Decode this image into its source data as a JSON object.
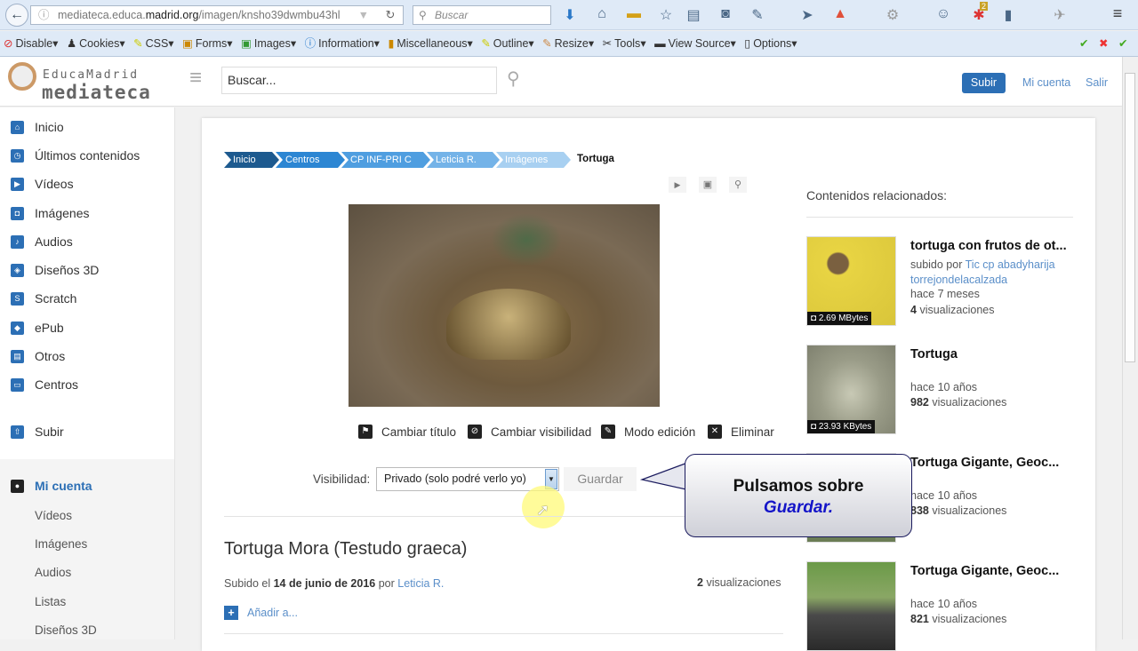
{
  "browser": {
    "url_host_pre": "mediateca.educa.",
    "url_host_bold": "madrid.org",
    "url_path": "/imagen/knsho39dwmbu43hl",
    "search_placeholder": "Buscar",
    "badge": "2",
    "bookmarks": [
      "Disable",
      "Cookies",
      "CSS",
      "Forms",
      "Images",
      "Information",
      "Miscellaneous",
      "Outline",
      "Resize",
      "Tools",
      "View Source",
      "Options"
    ]
  },
  "header": {
    "logo_top": "EducaMadrid",
    "logo_bottom": "mediateca",
    "search_placeholder": "Buscar...",
    "upload": "Subir",
    "account": "Mi cuenta",
    "logout": "Salir"
  },
  "sidebar": {
    "items": [
      "Inicio",
      "Últimos contenidos",
      "Vídeos",
      "Imágenes",
      "Audios",
      "Diseños 3D",
      "Scratch",
      "ePub",
      "Otros",
      "Centros"
    ],
    "upload": "Subir",
    "account": "Mi cuenta",
    "account_items": [
      "Vídeos",
      "Imágenes",
      "Audios",
      "Listas",
      "Diseños 3D"
    ]
  },
  "breadcrumb": [
    "Inicio",
    "Centros",
    "CP INF-PRI C",
    "Leticia R.",
    "Imágenes",
    "Tortuga"
  ],
  "actions": [
    "Cambiar título",
    "Cambiar visibilidad",
    "Modo edición",
    "Eliminar"
  ],
  "visibility": {
    "label": "Visibilidad:",
    "value": "Privado (solo podré verlo yo)",
    "save": "Guardar"
  },
  "media": {
    "title": "Tortuga Mora (Testudo graeca)",
    "uploaded_prefix": "Subido el",
    "date": "14 de junio de 2016",
    "by": "por",
    "author": "Leticia R.",
    "views_count": "2",
    "views_label": "visualizaciones",
    "add": "Añadir a..."
  },
  "callout": {
    "line1": "Pulsamos sobre",
    "line2": "Guardar."
  },
  "related": {
    "heading": "Contenidos relacionados:",
    "items": [
      {
        "title": "tortuga con frutos de ot...",
        "by_label": "subido por",
        "by": "Tic cp abadyharija torrejondelacalzada",
        "age": "hace 7 meses",
        "views": "4",
        "views_label": "visualizaciones",
        "size": "2.69 MBytes"
      },
      {
        "title": "Tortuga",
        "age": "hace 10 años",
        "views": "982",
        "views_label": "visualizaciones",
        "size": "23.93 KBytes"
      },
      {
        "title": "Tortuga Gigante, Geoc...",
        "age": "hace 10 años",
        "views": "838",
        "views_label": "visualizaciones"
      },
      {
        "title": "Tortuga Gigante, Geoc...",
        "age": "hace 10 años",
        "views": "821",
        "views_label": "visualizaciones"
      }
    ]
  },
  "colors": {
    "accent": "#2c6fb5",
    "link": "#5b8fc9"
  }
}
